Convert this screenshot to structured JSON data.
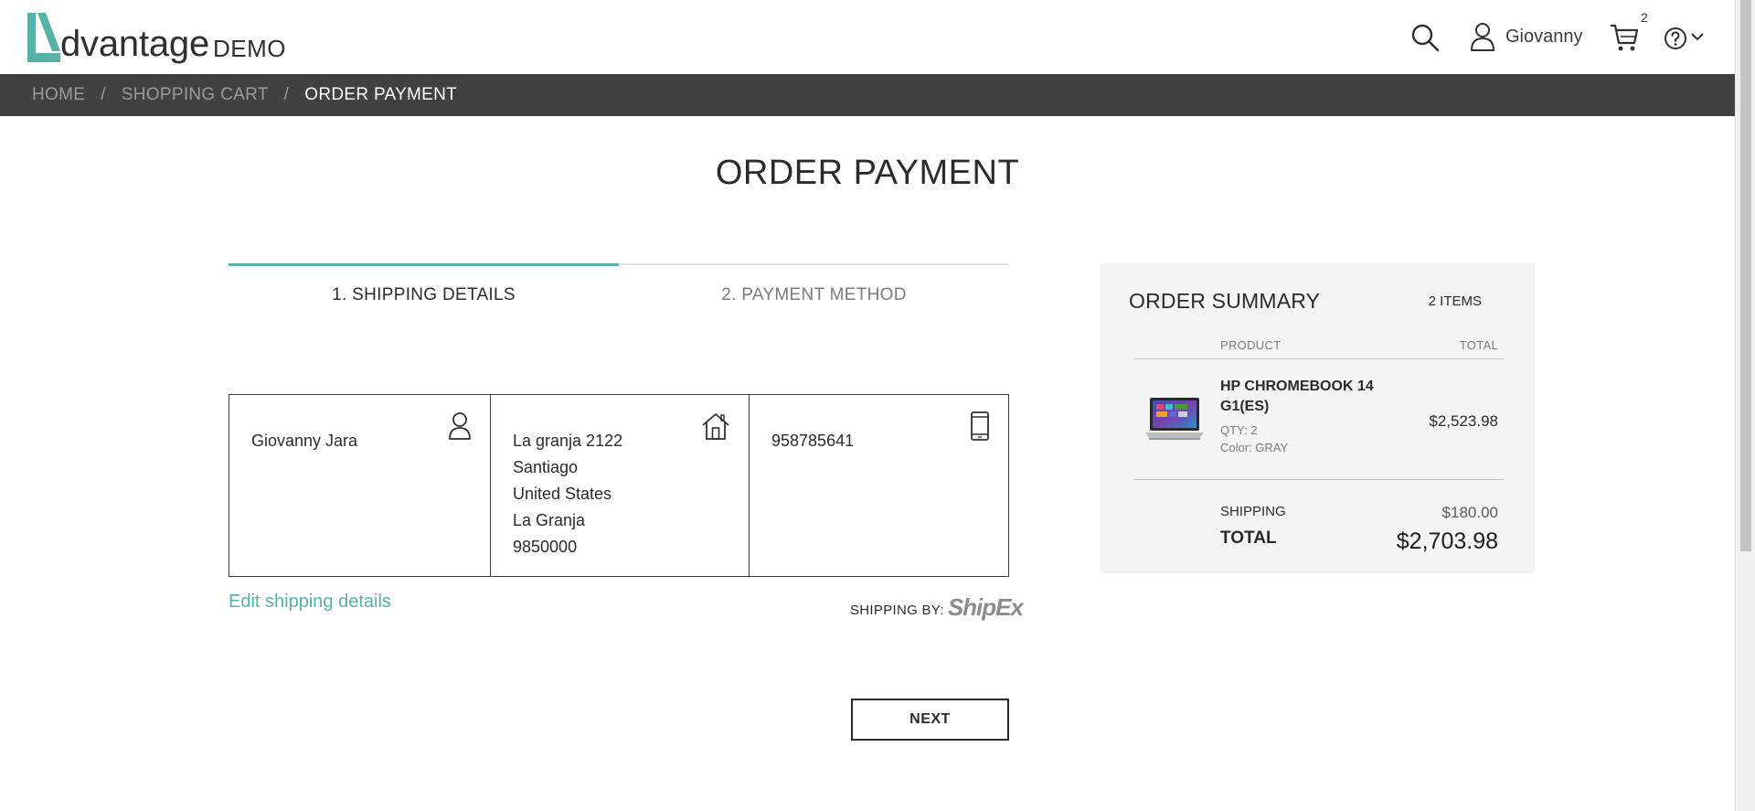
{
  "header": {
    "logo_word": "dvantage",
    "logo_suffix": "DEMO",
    "user_name": "Giovanny",
    "cart_count": "2",
    "icons": [
      "search-icon",
      "user-icon",
      "cart-icon",
      "help-icon",
      "chevron-down-icon"
    ]
  },
  "breadcrumb": {
    "items": [
      "HOME",
      "SHOPPING CART",
      "ORDER PAYMENT"
    ],
    "separator": "/"
  },
  "page": {
    "title": "ORDER PAYMENT"
  },
  "tabs": [
    {
      "label": "1. SHIPPING DETAILS",
      "active": true
    },
    {
      "label": "2. PAYMENT METHOD",
      "active": false
    }
  ],
  "shipping": {
    "name": "Giovanny Jara",
    "address_lines": [
      "La granja 2122",
      "Santiago",
      "United States",
      "La Granja",
      "9850000"
    ],
    "phone": "958785641",
    "edit_link": "Edit shipping details",
    "shipping_by_label": "SHIPPING BY:",
    "carrier_logo": "ShipEx"
  },
  "actions": {
    "next_label": "NEXT"
  },
  "summary": {
    "title": "ORDER SUMMARY",
    "item_count": "2 ITEMS",
    "col_product": "PRODUCT",
    "col_total": "TOTAL",
    "product": {
      "name": "HP CHROMEBOOK 14 G1(ES)",
      "qty": "QTY: 2",
      "color": "Color: GRAY",
      "total": "$2,523.98"
    },
    "shipping_label": "SHIPPING",
    "shipping_value": "$180.00",
    "total_label": "TOTAL",
    "total_value": "$2,703.98"
  },
  "colors": {
    "accent": "#54b2a9",
    "breadcrumb_bg": "#414141",
    "summary_bg": "#f4f4f4"
  }
}
